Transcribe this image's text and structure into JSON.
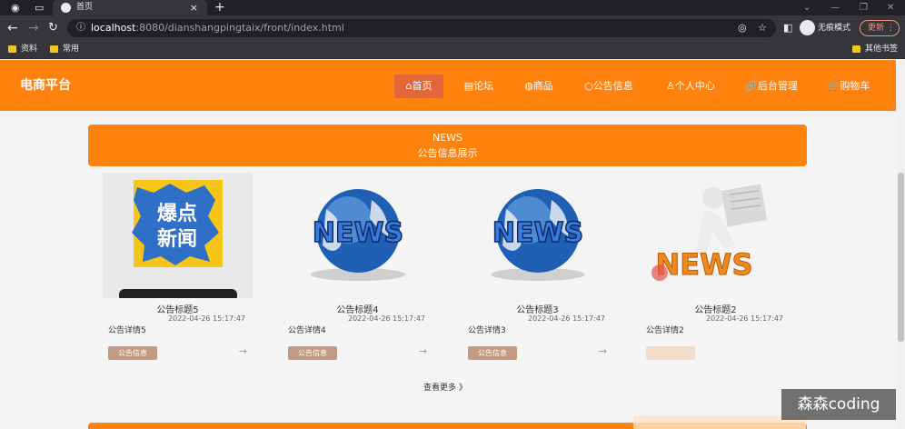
{
  "browser": {
    "tab_title": "首页",
    "tab_close": "×",
    "new_tab": "+",
    "url_host": "localhost",
    "url_rest": ":8080/dianshangpingtaix/front/index.html",
    "incognito_label": "无痕模式",
    "update_label": "更新",
    "bookmarks": [
      "资料",
      "常用"
    ],
    "other_bookmarks": "其他书签"
  },
  "site": {
    "brand": "电商平台",
    "nav": [
      {
        "label": "⌂首页"
      },
      {
        "label": "▤论坛"
      },
      {
        "label": "◍商品"
      },
      {
        "label": "○公告信息"
      },
      {
        "label": "♙个人中心"
      },
      {
        "label": "🔗后台管理"
      },
      {
        "label": "🛒购物车"
      }
    ]
  },
  "news": {
    "banner_en": "NEWS",
    "banner_cn": "公告信息展示",
    "cards": [
      {
        "image": "爆点新闻",
        "title": "公告标题5",
        "time": "2022-04-26 15:17:47",
        "detail": "公告详情5",
        "tag": "公告信息",
        "arrow": "→"
      },
      {
        "image": "NEWS",
        "title": "公告标题4",
        "time": "2022-04-26 15:17:47",
        "detail": "公告详情4",
        "tag": "公告信息",
        "arrow": "→"
      },
      {
        "image": "NEWS",
        "title": "公告标题3",
        "time": "2022-04-26 15:17:47",
        "detail": "公告详情3",
        "tag": "公告信息",
        "arrow": "→"
      },
      {
        "image": "NEWS",
        "title": "公告标题2",
        "time": "2022-04-26 15:17:47",
        "detail": "公告详情2",
        "tag": "",
        "arrow": ""
      }
    ],
    "more_label": "查看更多 》"
  },
  "watermark": "森森coding",
  "colors": {
    "accent": "#ff820e",
    "active_nav": "#e2673a",
    "tag": "#c49a83"
  }
}
